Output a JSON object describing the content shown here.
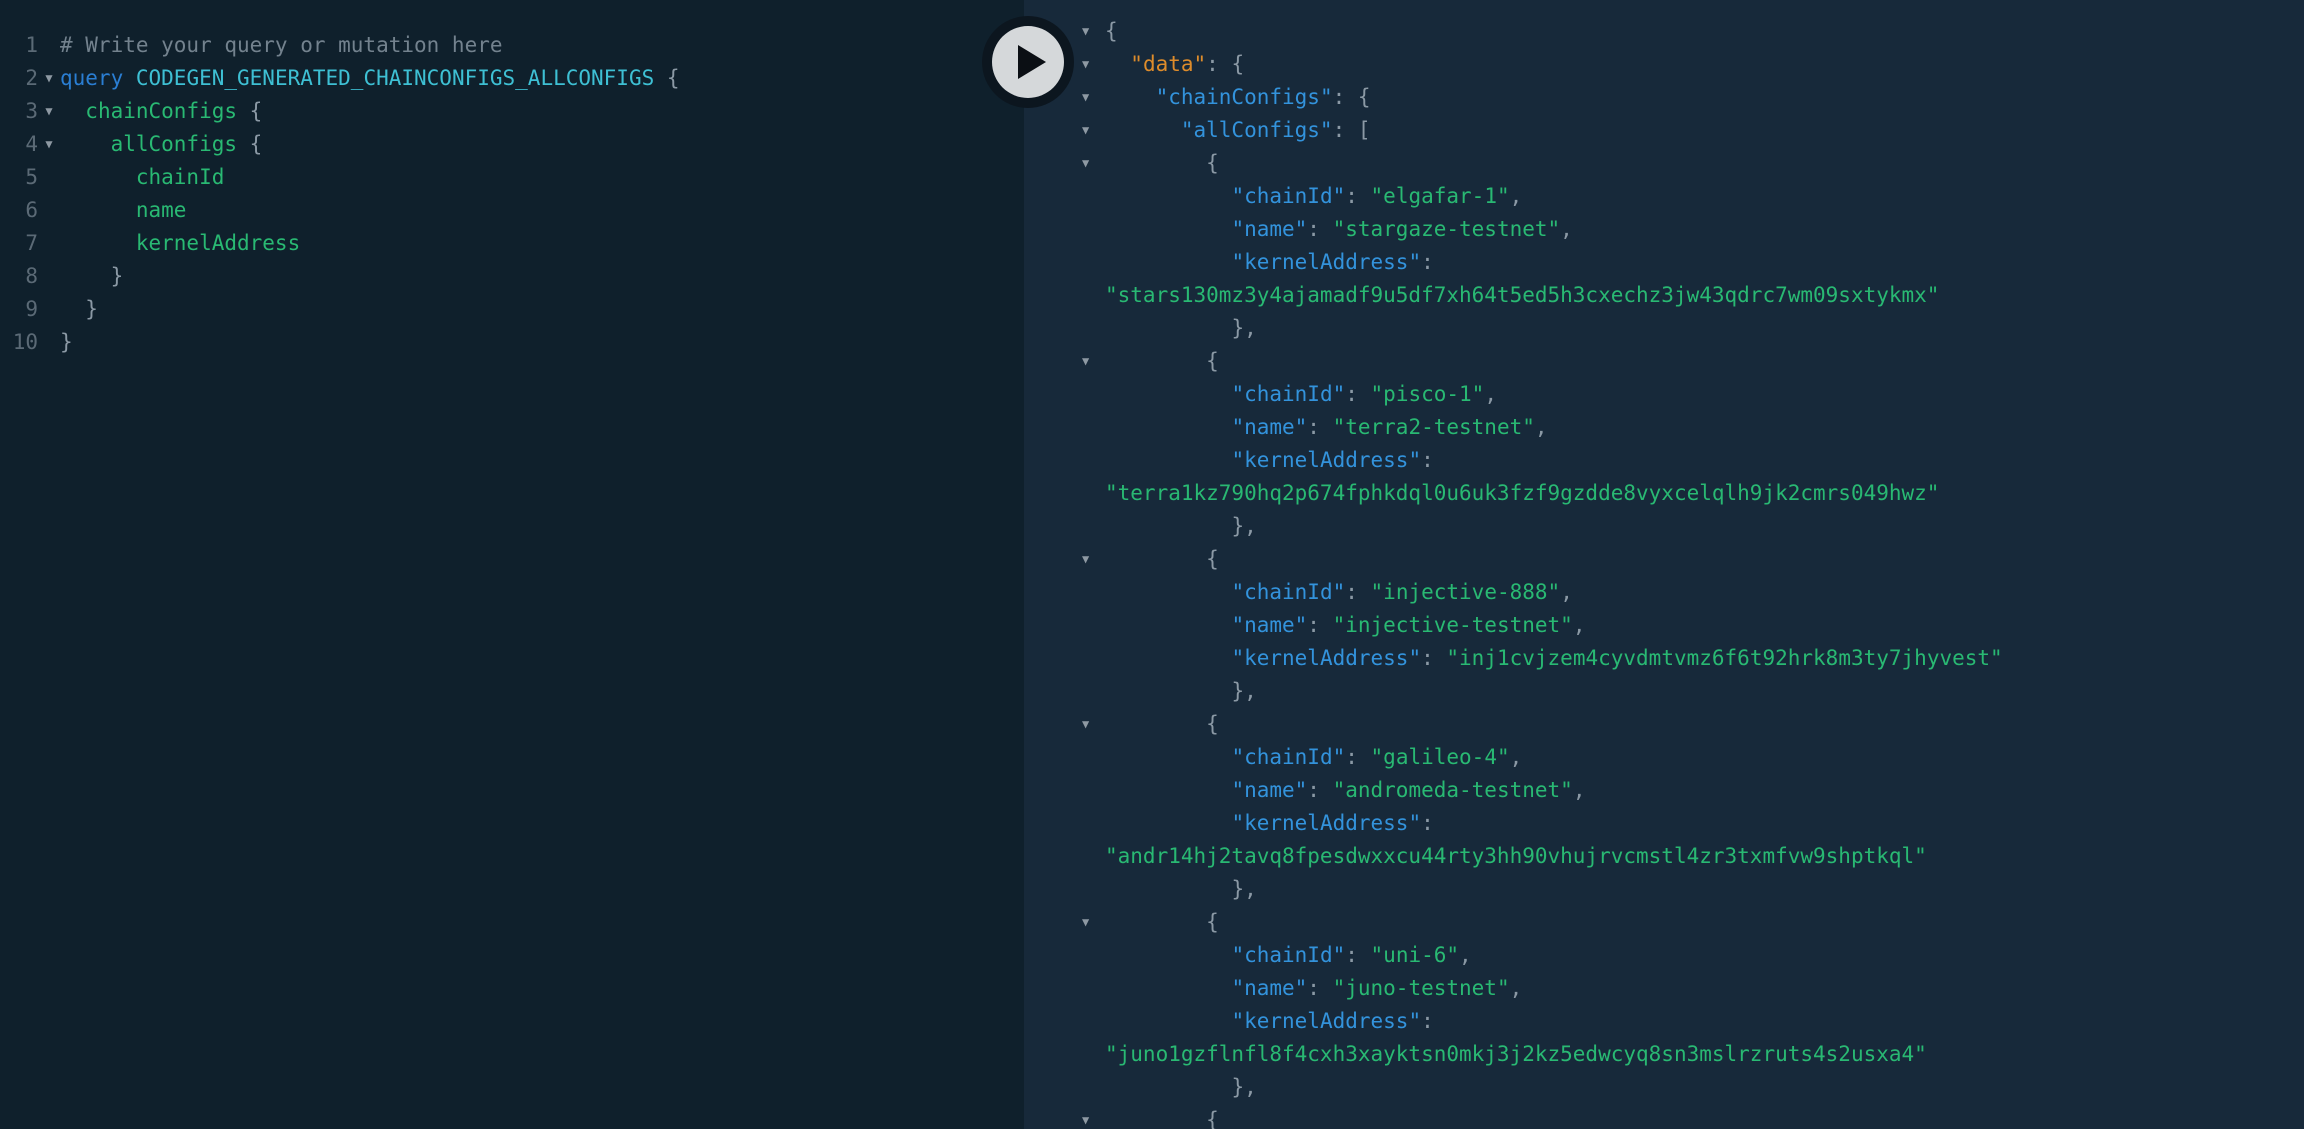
{
  "app": {
    "kind": "GraphQL playground: query editor with JSON response pane"
  },
  "colors": {
    "editor_bg": "#0F202C",
    "response_bg": "#17293A",
    "keyword": "#2A7ED3",
    "operation_name": "#3EC0D4",
    "field": "#29B973",
    "string": "#29B973",
    "key": "#3393DC",
    "key_data": "#DE8C2B",
    "punctuation": "#8B99A5",
    "comment": "#73828E",
    "line_number": "#5B6A76",
    "fold_arrow": "#8E99A3",
    "play_ring": "#0C161F",
    "play_face": "#D5D8DA",
    "play_icon": "#0B0F14"
  },
  "execute_button": {
    "icon": "play"
  },
  "editor": {
    "lines": [
      {
        "num": "1",
        "fold": false,
        "tokens": [
          [
            "comment",
            "# Write your query or mutation here"
          ]
        ]
      },
      {
        "num": "2",
        "fold": true,
        "tokens": [
          [
            "keyword",
            "query"
          ],
          [
            "plain",
            " "
          ],
          [
            "def",
            "CODEGEN_GENERATED_CHAINCONFIGS_ALLCONFIGS"
          ],
          [
            "plain",
            " "
          ],
          [
            "punct",
            "{"
          ]
        ]
      },
      {
        "num": "3",
        "fold": true,
        "tokens": [
          [
            "plain",
            "  "
          ],
          [
            "field",
            "chainConfigs"
          ],
          [
            "plain",
            " "
          ],
          [
            "punct",
            "{"
          ]
        ]
      },
      {
        "num": "4",
        "fold": true,
        "tokens": [
          [
            "plain",
            "    "
          ],
          [
            "field",
            "allConfigs"
          ],
          [
            "plain",
            " "
          ],
          [
            "punct",
            "{"
          ]
        ]
      },
      {
        "num": "5",
        "fold": false,
        "tokens": [
          [
            "plain",
            "      "
          ],
          [
            "field",
            "chainId"
          ]
        ]
      },
      {
        "num": "6",
        "fold": false,
        "tokens": [
          [
            "plain",
            "      "
          ],
          [
            "field",
            "name"
          ]
        ]
      },
      {
        "num": "7",
        "fold": false,
        "tokens": [
          [
            "plain",
            "      "
          ],
          [
            "field",
            "kernelAddress"
          ]
        ]
      },
      {
        "num": "8",
        "fold": false,
        "tokens": [
          [
            "plain",
            "    "
          ],
          [
            "punct",
            "}"
          ]
        ]
      },
      {
        "num": "9",
        "fold": false,
        "tokens": [
          [
            "plain",
            "  "
          ],
          [
            "punct",
            "}"
          ]
        ]
      },
      {
        "num": "10",
        "fold": false,
        "tokens": [
          [
            "punct",
            "}"
          ]
        ]
      }
    ]
  },
  "response": {
    "records": [
      {
        "chainId": "elgafar-1",
        "name": "stargaze-testnet",
        "kernelAddress": "stars130mz3y4ajamadf9u5df7xh64t5ed5h3cxechz3jw43qdrc7wm09sxtykmx"
      },
      {
        "chainId": "pisco-1",
        "name": "terra2-testnet",
        "kernelAddress": "terra1kz790hq2p674fphkdql0u6uk3fzf9gzdde8vyxcelqlh9jk2cmrs049hwz"
      },
      {
        "chainId": "injective-888",
        "name": "injective-testnet",
        "kernelAddress": "inj1cvjzem4cyvdmtvmz6f6t92hrk8m3ty7jhyvest"
      },
      {
        "chainId": "galileo-4",
        "name": "andromeda-testnet",
        "kernelAddress": "andr14hj2tavq8fpesdwxxcu44rty3hh90vhujrvcmstl4zr3txmfvw9shptkql"
      },
      {
        "chainId": "uni-6",
        "name": "juno-testnet",
        "kernelAddress": "juno1gzflnfl8f4cxh3xayktsn0mkj3j2kz5edwcyq8sn3mslrzruts4s2usxa4"
      }
    ],
    "lines": [
      {
        "fold": true,
        "tokens": [
          [
            "punct",
            "{"
          ]
        ]
      },
      {
        "fold": true,
        "tokens": [
          [
            "plain",
            "  "
          ],
          [
            "keydata",
            "\"data\""
          ],
          [
            "punct",
            ": {"
          ]
        ]
      },
      {
        "fold": true,
        "tokens": [
          [
            "plain",
            "    "
          ],
          [
            "key",
            "\"chainConfigs\""
          ],
          [
            "punct",
            ": {"
          ]
        ]
      },
      {
        "fold": true,
        "tokens": [
          [
            "plain",
            "      "
          ],
          [
            "key",
            "\"allConfigs\""
          ],
          [
            "punct",
            ": ["
          ]
        ]
      },
      {
        "fold": true,
        "tokens": [
          [
            "plain",
            "        "
          ],
          [
            "punct",
            "{"
          ]
        ]
      },
      {
        "fold": false,
        "tokens": [
          [
            "plain",
            "          "
          ],
          [
            "key",
            "\"chainId\""
          ],
          [
            "punct",
            ": "
          ],
          [
            "string",
            "\"elgafar-1\""
          ],
          [
            "punct",
            ","
          ]
        ]
      },
      {
        "fold": false,
        "tokens": [
          [
            "plain",
            "          "
          ],
          [
            "key",
            "\"name\""
          ],
          [
            "punct",
            ": "
          ],
          [
            "string",
            "\"stargaze-testnet\""
          ],
          [
            "punct",
            ","
          ]
        ]
      },
      {
        "fold": false,
        "tokens": [
          [
            "plain",
            "          "
          ],
          [
            "key",
            "\"kernelAddress\""
          ],
          [
            "punct",
            ":"
          ]
        ]
      },
      {
        "fold": false,
        "tokens": [
          [
            "string",
            "\"stars130mz3y4ajamadf9u5df7xh64t5ed5h3cxechz3jw43qdrc7wm09sxtykmx\""
          ]
        ]
      },
      {
        "fold": false,
        "tokens": [
          [
            "plain",
            "          "
          ],
          [
            "punct",
            "},"
          ]
        ]
      },
      {
        "fold": true,
        "tokens": [
          [
            "plain",
            "        "
          ],
          [
            "punct",
            "{"
          ]
        ]
      },
      {
        "fold": false,
        "tokens": [
          [
            "plain",
            "          "
          ],
          [
            "key",
            "\"chainId\""
          ],
          [
            "punct",
            ": "
          ],
          [
            "string",
            "\"pisco-1\""
          ],
          [
            "punct",
            ","
          ]
        ]
      },
      {
        "fold": false,
        "tokens": [
          [
            "plain",
            "          "
          ],
          [
            "key",
            "\"name\""
          ],
          [
            "punct",
            ": "
          ],
          [
            "string",
            "\"terra2-testnet\""
          ],
          [
            "punct",
            ","
          ]
        ]
      },
      {
        "fold": false,
        "tokens": [
          [
            "plain",
            "          "
          ],
          [
            "key",
            "\"kernelAddress\""
          ],
          [
            "punct",
            ":"
          ]
        ]
      },
      {
        "fold": false,
        "tokens": [
          [
            "string",
            "\"terra1kz790hq2p674fphkdql0u6uk3fzf9gzdde8vyxcelqlh9jk2cmrs049hwz\""
          ]
        ]
      },
      {
        "fold": false,
        "tokens": [
          [
            "plain",
            "          "
          ],
          [
            "punct",
            "},"
          ]
        ]
      },
      {
        "fold": true,
        "tokens": [
          [
            "plain",
            "        "
          ],
          [
            "punct",
            "{"
          ]
        ]
      },
      {
        "fold": false,
        "tokens": [
          [
            "plain",
            "          "
          ],
          [
            "key",
            "\"chainId\""
          ],
          [
            "punct",
            ": "
          ],
          [
            "string",
            "\"injective-888\""
          ],
          [
            "punct",
            ","
          ]
        ]
      },
      {
        "fold": false,
        "tokens": [
          [
            "plain",
            "          "
          ],
          [
            "key",
            "\"name\""
          ],
          [
            "punct",
            ": "
          ],
          [
            "string",
            "\"injective-testnet\""
          ],
          [
            "punct",
            ","
          ]
        ]
      },
      {
        "fold": false,
        "tokens": [
          [
            "plain",
            "          "
          ],
          [
            "key",
            "\"kernelAddress\""
          ],
          [
            "punct",
            ": "
          ],
          [
            "string",
            "\"inj1cvjzem4cyvdmtvmz6f6t92hrk8m3ty7jhyvest\""
          ]
        ]
      },
      {
        "fold": false,
        "tokens": [
          [
            "plain",
            "          "
          ],
          [
            "punct",
            "},"
          ]
        ]
      },
      {
        "fold": true,
        "tokens": [
          [
            "plain",
            "        "
          ],
          [
            "punct",
            "{"
          ]
        ]
      },
      {
        "fold": false,
        "tokens": [
          [
            "plain",
            "          "
          ],
          [
            "key",
            "\"chainId\""
          ],
          [
            "punct",
            ": "
          ],
          [
            "string",
            "\"galileo-4\""
          ],
          [
            "punct",
            ","
          ]
        ]
      },
      {
        "fold": false,
        "tokens": [
          [
            "plain",
            "          "
          ],
          [
            "key",
            "\"name\""
          ],
          [
            "punct",
            ": "
          ],
          [
            "string",
            "\"andromeda-testnet\""
          ],
          [
            "punct",
            ","
          ]
        ]
      },
      {
        "fold": false,
        "tokens": [
          [
            "plain",
            "          "
          ],
          [
            "key",
            "\"kernelAddress\""
          ],
          [
            "punct",
            ":"
          ]
        ]
      },
      {
        "fold": false,
        "tokens": [
          [
            "string",
            "\"andr14hj2tavq8fpesdwxxcu44rty3hh90vhujrvcmstl4zr3txmfvw9shptkql\""
          ]
        ]
      },
      {
        "fold": false,
        "tokens": [
          [
            "plain",
            "          "
          ],
          [
            "punct",
            "},"
          ]
        ]
      },
      {
        "fold": true,
        "tokens": [
          [
            "plain",
            "        "
          ],
          [
            "punct",
            "{"
          ]
        ]
      },
      {
        "fold": false,
        "tokens": [
          [
            "plain",
            "          "
          ],
          [
            "key",
            "\"chainId\""
          ],
          [
            "punct",
            ": "
          ],
          [
            "string",
            "\"uni-6\""
          ],
          [
            "punct",
            ","
          ]
        ]
      },
      {
        "fold": false,
        "tokens": [
          [
            "plain",
            "          "
          ],
          [
            "key",
            "\"name\""
          ],
          [
            "punct",
            ": "
          ],
          [
            "string",
            "\"juno-testnet\""
          ],
          [
            "punct",
            ","
          ]
        ]
      },
      {
        "fold": false,
        "tokens": [
          [
            "plain",
            "          "
          ],
          [
            "key",
            "\"kernelAddress\""
          ],
          [
            "punct",
            ":"
          ]
        ]
      },
      {
        "fold": false,
        "tokens": [
          [
            "string",
            "\"juno1gzflnfl8f4cxh3xayktsn0mkj3j2kz5edwcyq8sn3mslrzruts4s2usxa4\""
          ]
        ]
      },
      {
        "fold": false,
        "tokens": [
          [
            "plain",
            "          "
          ],
          [
            "punct",
            "},"
          ]
        ]
      },
      {
        "fold": true,
        "tokens": [
          [
            "plain",
            "        "
          ],
          [
            "punct",
            "{"
          ]
        ]
      }
    ]
  }
}
